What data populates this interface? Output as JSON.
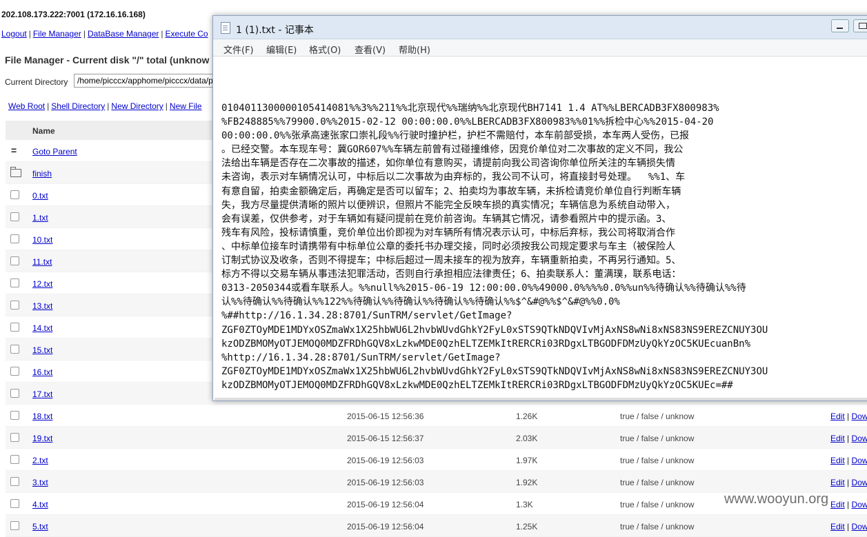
{
  "host": "202.108.173.222:7001 (172.16.16.168)",
  "top_links": [
    "Logout",
    "File Manager",
    "DataBase Manager",
    "Execute Co"
  ],
  "fm_title": "File Manager - Current disk \"/\" total (unknow",
  "current_dir_label": "Current Directory",
  "current_dir_value": "/home/picccx/apphome/picccx/data/p",
  "actions": [
    "Web Root",
    "Shell Directory",
    "New Directory",
    "New File"
  ],
  "table": {
    "header_name": "Name",
    "rows": [
      {
        "kind": "parent",
        "name": "Goto Parent"
      },
      {
        "kind": "folder",
        "name": "finish"
      },
      {
        "kind": "file",
        "name": "0.txt"
      },
      {
        "kind": "file",
        "name": "1.txt"
      },
      {
        "kind": "file",
        "name": "10.txt"
      },
      {
        "kind": "file",
        "name": "11.txt"
      },
      {
        "kind": "file",
        "name": "12.txt"
      },
      {
        "kind": "file",
        "name": "13.txt"
      },
      {
        "kind": "file",
        "name": "14.txt"
      },
      {
        "kind": "file",
        "name": "15.txt"
      },
      {
        "kind": "file",
        "name": "16.txt"
      },
      {
        "kind": "file",
        "name": "17.txt"
      },
      {
        "kind": "file",
        "name": "18.txt",
        "time": "2015-06-15 12:56:36",
        "size": "1.26K",
        "perm": "true / false / unknow",
        "edit": "Edit",
        "down": "Dow"
      },
      {
        "kind": "file",
        "name": "19.txt",
        "time": "2015-06-15 12:56:37",
        "size": "2.03K",
        "perm": "true / false / unknow",
        "edit": "Edit",
        "down": "Dow"
      },
      {
        "kind": "file",
        "name": "2.txt",
        "time": "2015-06-19 12:56:03",
        "size": "1.97K",
        "perm": "true / false / unknow",
        "edit": "Edit",
        "down": "Dow"
      },
      {
        "kind": "file",
        "name": "3.txt",
        "time": "2015-06-19 12:56:03",
        "size": "1.92K",
        "perm": "true / false / unknow",
        "edit": "Edit",
        "down": "Dow"
      },
      {
        "kind": "file",
        "name": "4.txt",
        "time": "2015-06-19 12:56:04",
        "size": "1.3K",
        "perm": "true / false / unknow",
        "edit": "Edit",
        "down": "Dow"
      },
      {
        "kind": "file",
        "name": "5.txt",
        "time": "2015-06-19 12:56:04",
        "size": "1.25K",
        "perm": "true / false / unknow",
        "edit": "Edit",
        "down": "Dow"
      }
    ]
  },
  "notepad": {
    "title": "1 (1).txt - 记事本",
    "menu": [
      "文件(F)",
      "编辑(E)",
      "格式(O)",
      "查看(V)",
      "帮助(H)"
    ],
    "lines": [
      "0104011300000105414081%%3%%211%%北京现代%%瑞纳%%北京现代BH7141 1.4 AT%%LBERCADB3FX800983%",
      "%FB248885%%79900.0%%2015-02-12 00:00:00.0%%LBERCADB3FX800983%%01%%拆检中心%%2015-04-20",
      "00:00:00.0%%张承高速张家口崇礼段%%行驶时撞护栏，护栏不需赔付，本车前部受损，本车两人受伤，已报",
      "。已经交警。本车现车号：冀GOR607%%车辆左前曾有过碰撞维修，因竞价单位对二次事故的定义不同，我公",
      "法给出车辆是否存在二次事故的描述，如你单位有意购买，请提前向我公司咨询你单位所关注的车辆损失情",
      "未咨询，表示对车辆情况认可，中标后以二次事故为由弃标的，我公司不认可，将直接封号处理。  %%1、车",
      "有意自留，拍卖金额确定后，再确定是否可以留车；2、拍卖均为事故车辆，未拆检请竞价单位自行判断车辆",
      "失，我方尽量提供清晰的照片以便辨识，但照片不能完全反映车损的真实情况；车辆信息为系统自动带入，",
      "会有误差，仅供参考，对于车辆如有疑问提前在竞价前咨询。车辆其它情况，请参看照片中的提示函。3、",
      "残车有风险，投标请慎重，竞价单位出价即视为对车辆所有情况表示认可，中标后弃标，我公司将取消合作",
      "、中标单位接车时请携带有中标单位公章的委托书办理交接，同时必须按我公司规定要求与车主（被保险人",
      "订制式协议及收条，否则不得提车；中标后超过一周未接车的视为放弃，车辆重新拍卖，不再另行通知。5、",
      "标方不得以交易车辆从事违法犯罪活动，否则自行承担相应法律责任；6、拍卖联系人：董满璞，联系电话：",
      "0313-2050344或看车联系人。%%null%%2015-06-19 12:00:00.0%%49000.0%%%%0.0%%un%%待确认%%待确认%%待",
      "认%%待确认%%待确认%%122%%待确认%%待确认%%待确认%%待确认%%$^&#@%%$^&#@%%0.0%",
      "%##http://16.1.34.28:8701/SunTRM/servlet/GetImage?",
      "ZGF0ZTOyMDE1MDYxOSZmaWx1X25hbWU6L2hvbWUvdGhkY2FyL0xSTS9QTkNDQVIvMjAxNS8wNi8xNS83NS9EREZCNUY3OU",
      "kzODZBMOMyOTJEMOQ0MDZFRDhGQV8xLzkwMDE0QzhELTZEMkItRERCRi03RDgxLTBGODFDMzUyQkYzOC5KUEcuanBn%",
      "%http://16.1.34.28:8701/SunTRM/servlet/GetImage?",
      "ZGF0ZTOyMDE1MDYxOSZmaWx1X25hbWU6L2hvbWUvdGhkY2FyL0xSTS9QTkNDQVIvMjAxNS8wNi8xNS83NS9EREZCNUY3OU",
      "kzODZBMOMyOTJEMOQ0MDZFRDhGQV8xLzkwMDE0QzhELTZEMkItRERCRi03RDgxLTBGODFDMzUyQkYzOC5KUEc=##"
    ]
  },
  "watermark": "www.wooyun.org"
}
